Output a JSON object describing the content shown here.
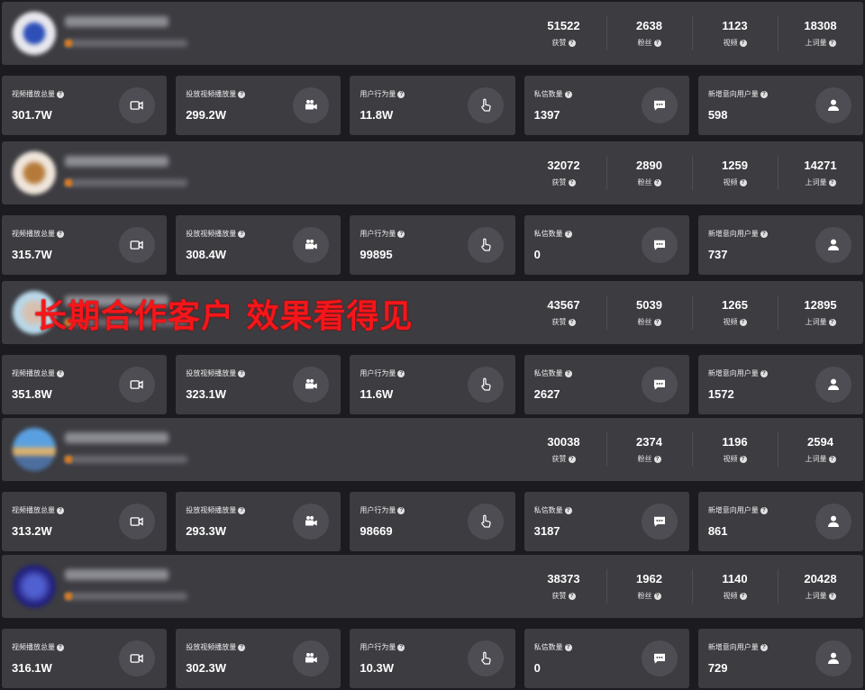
{
  "profile_stat_labels": [
    "获赞",
    "粉丝",
    "视频",
    "上词量"
  ],
  "metric_labels": [
    "视频播放总量",
    "投放视频播放量",
    "用户行为量",
    "私信数量",
    "新增意向用户量"
  ],
  "metric_icons": [
    "video-camera-icon",
    "movie-camera-icon",
    "touch-hand-icon",
    "message-bubble-icon",
    "user-icon"
  ],
  "banner_text": "长期合作客户 效果看得见",
  "accounts": [
    {
      "profile_stats": [
        "51522",
        "2638",
        "1123",
        "18308"
      ],
      "metrics": [
        "301.7W",
        "299.2W",
        "11.8W",
        "1397",
        "598"
      ]
    },
    {
      "profile_stats": [
        "32072",
        "2890",
        "1259",
        "14271"
      ],
      "metrics": [
        "315.7W",
        "308.4W",
        "99895",
        "0",
        "737"
      ]
    },
    {
      "profile_stats": [
        "43567",
        "5039",
        "1265",
        "12895"
      ],
      "metrics": [
        "351.8W",
        "323.1W",
        "11.6W",
        "2627",
        "1572"
      ]
    },
    {
      "profile_stats": [
        "30038",
        "2374",
        "1196",
        "2594"
      ],
      "metrics": [
        "313.2W",
        "293.3W",
        "98669",
        "3187",
        "861"
      ]
    },
    {
      "profile_stats": [
        "38373",
        "1962",
        "1140",
        "20428"
      ],
      "metrics": [
        "316.1W",
        "302.3W",
        "10.3W",
        "0",
        "729"
      ]
    }
  ]
}
